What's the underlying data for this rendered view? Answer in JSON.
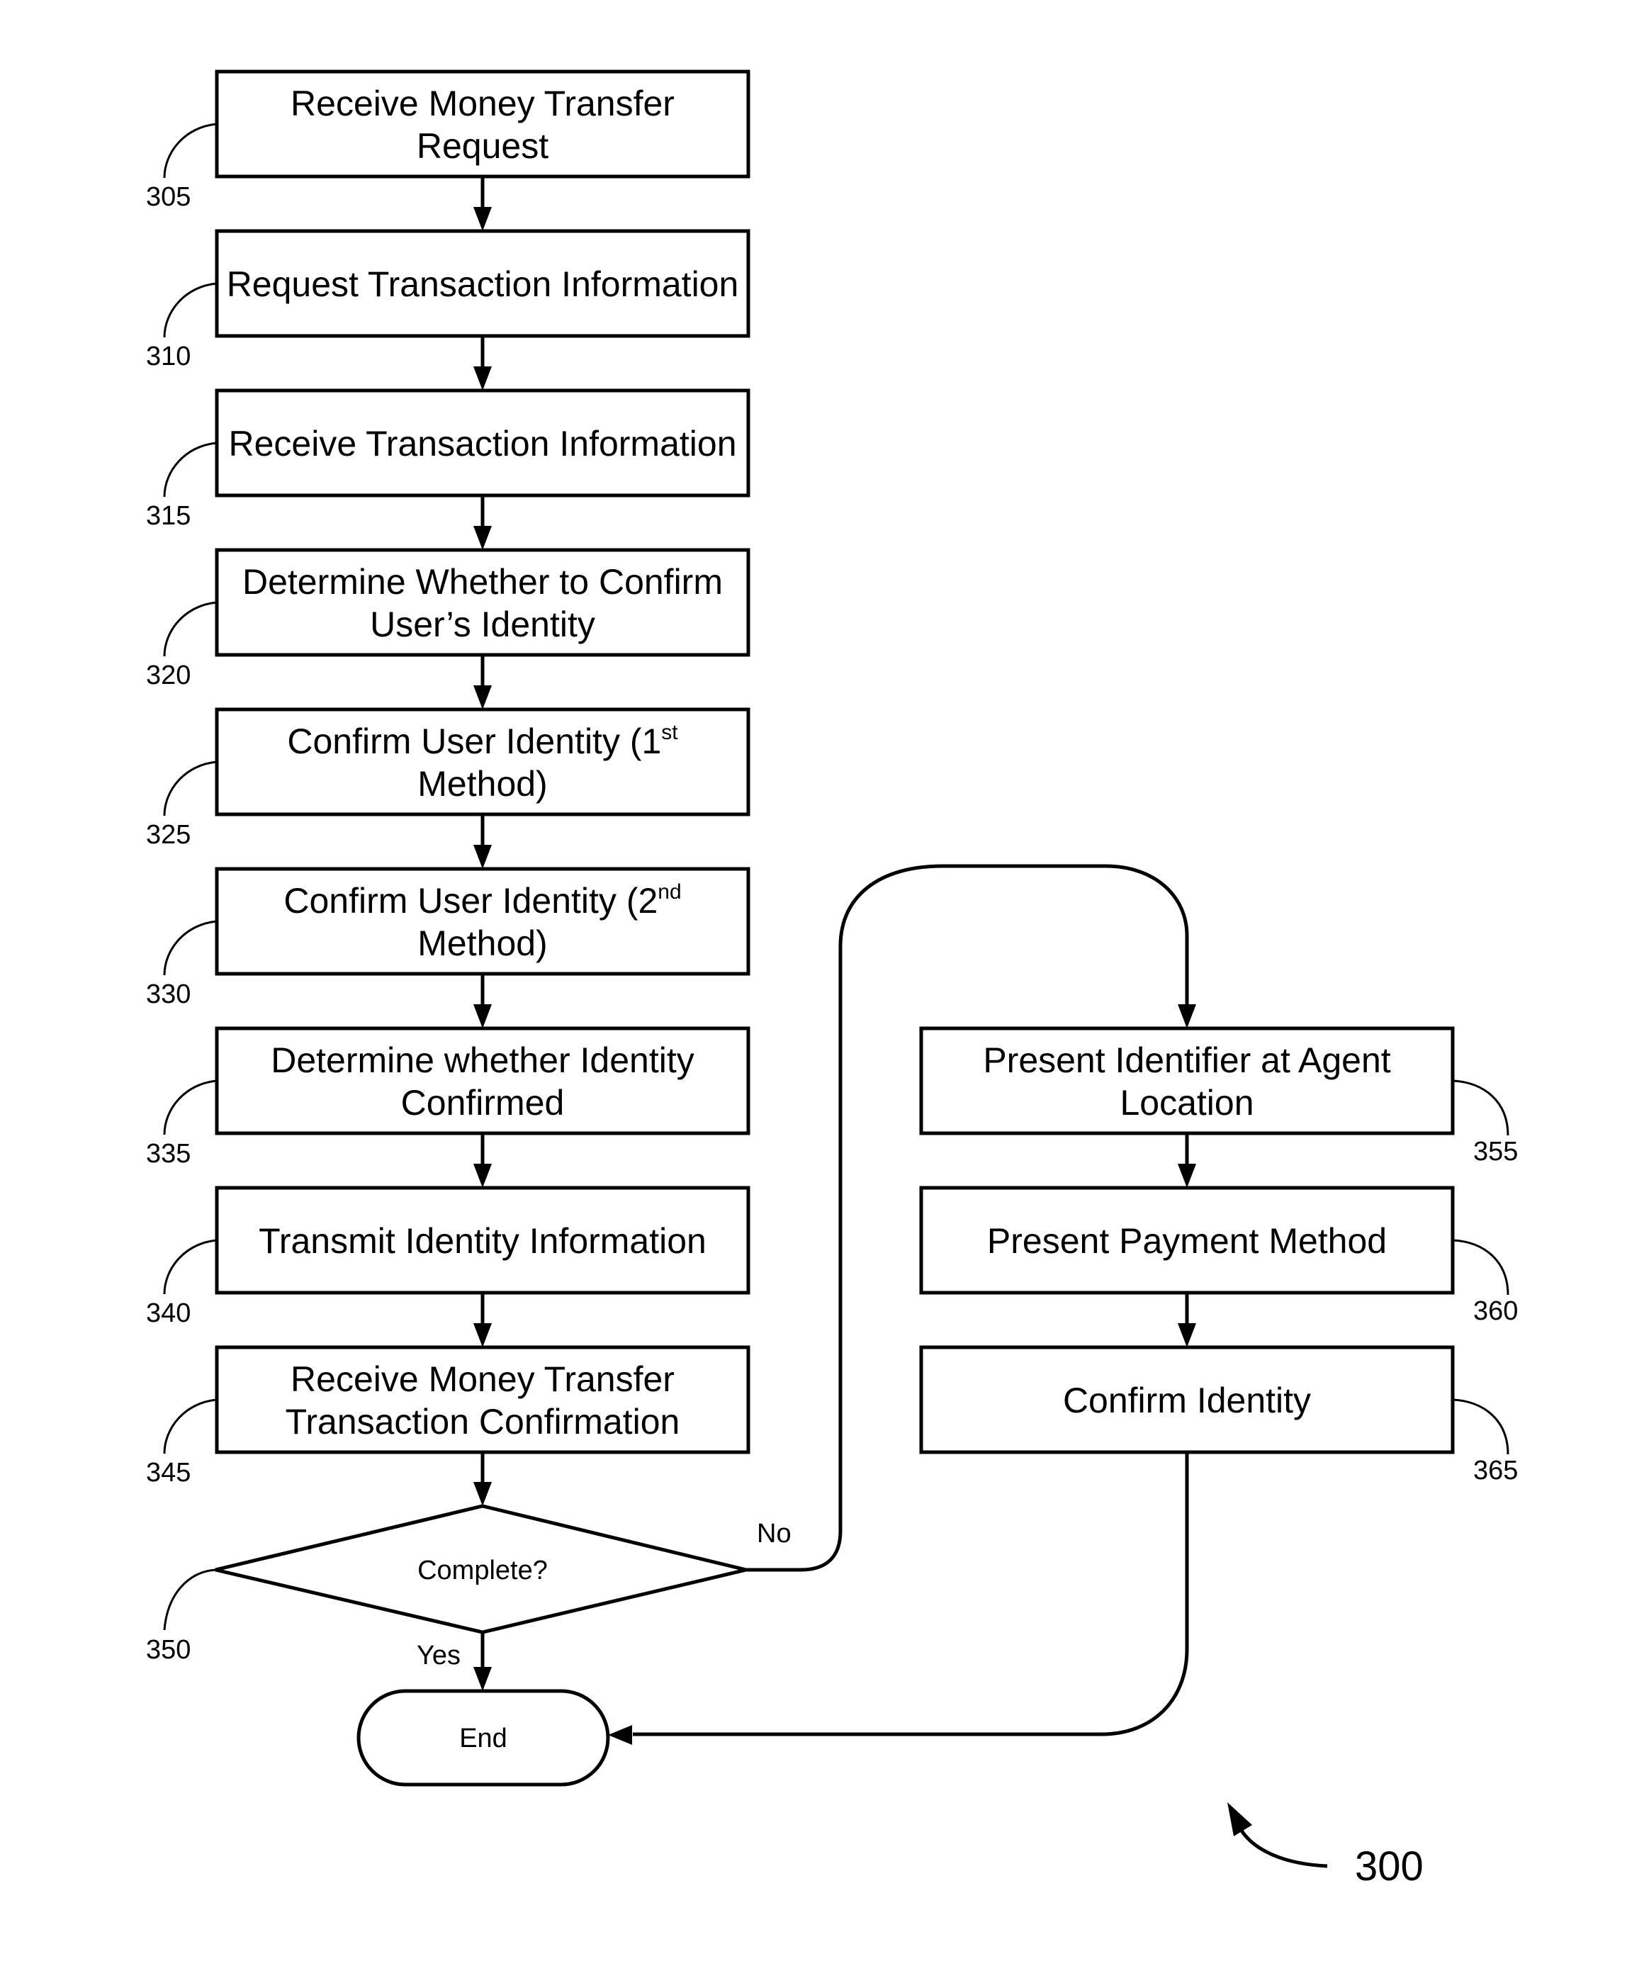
{
  "figure": {
    "number": "300",
    "colors": {
      "stroke": "#000000",
      "background": "#ffffff"
    }
  },
  "steps_left": [
    {
      "ref": "305",
      "lines": [
        "Receive Money Transfer",
        "Request"
      ]
    },
    {
      "ref": "310",
      "lines": [
        "Request Transaction Information"
      ]
    },
    {
      "ref": "315",
      "lines": [
        "Receive Transaction Information"
      ]
    },
    {
      "ref": "320",
      "lines": [
        "Determine Whether to Confirm",
        "User’s Identity"
      ]
    },
    {
      "ref": "325",
      "lines": [
        "Confirm User Identity (1",
        "Method)"
      ],
      "sup": "st"
    },
    {
      "ref": "330",
      "lines": [
        "Confirm User Identity (2",
        "Method)"
      ],
      "sup": "nd"
    },
    {
      "ref": "335",
      "lines": [
        "Determine whether Identity",
        "Confirmed"
      ]
    },
    {
      "ref": "340",
      "lines": [
        "Transmit Identity Information"
      ]
    },
    {
      "ref": "345",
      "lines": [
        "Receive Money Transfer",
        "Transaction Confirmation"
      ]
    }
  ],
  "decision": {
    "ref": "350",
    "label": "Complete?",
    "yes_label": "Yes",
    "no_label": "No"
  },
  "terminal": {
    "label": "End"
  },
  "steps_right": [
    {
      "ref": "355",
      "lines": [
        "Present Identifier at Agent",
        "Location"
      ]
    },
    {
      "ref": "360",
      "lines": [
        "Present Payment Method"
      ]
    },
    {
      "ref": "365",
      "lines": [
        "Confirm Identity"
      ]
    }
  ]
}
